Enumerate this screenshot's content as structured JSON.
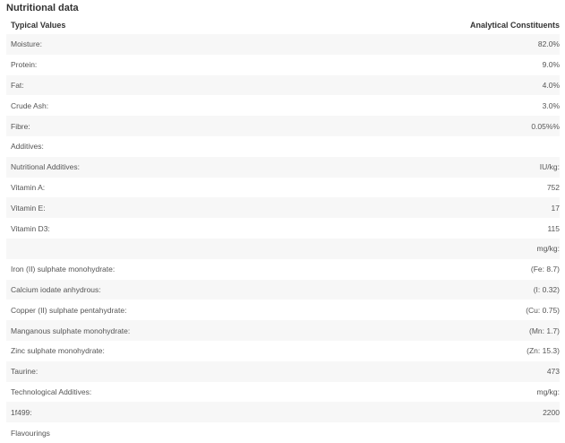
{
  "title": "Nutritional data",
  "header": {
    "col1": "Typical Values",
    "col2": "Analytical Constituents"
  },
  "rows": [
    {
      "label": "Moisture:",
      "value": "82.0%"
    },
    {
      "label": "Protein:",
      "value": "9.0%"
    },
    {
      "label": "Fat:",
      "value": "4.0%"
    },
    {
      "label": "Crude Ash:",
      "value": "3.0%"
    },
    {
      "label": "Fibre:",
      "value": "0.05%%"
    },
    {
      "label": "Additives:",
      "value": ""
    },
    {
      "label": "Nutritional Additives:",
      "value": "IU/kg:"
    },
    {
      "label": "Vitamin A:",
      "value": "752"
    },
    {
      "label": "Vitamin E:",
      "value": "17"
    },
    {
      "label": "Vitamin D3:",
      "value": "115"
    },
    {
      "label": "",
      "value": "mg/kg:"
    },
    {
      "label": "Iron (II) sulphate monohydrate:",
      "value": "(Fe: 8.7)"
    },
    {
      "label": "Calcium iodate anhydrous:",
      "value": "(I: 0.32)"
    },
    {
      "label": "Copper (II) sulphate pentahydrate:",
      "value": "(Cu: 0.75)"
    },
    {
      "label": "Manganous sulphate monohydrate:",
      "value": "(Mn: 1.7)"
    },
    {
      "label": "Zinc sulphate monohydrate:",
      "value": "(Zn: 15.3)"
    },
    {
      "label": "Taurine:",
      "value": "473"
    },
    {
      "label": "Technological Additives:",
      "value": "mg/kg:"
    },
    {
      "label": "1f499:",
      "value": "2200"
    },
    {
      "label": "Flavourings",
      "value": ""
    }
  ]
}
